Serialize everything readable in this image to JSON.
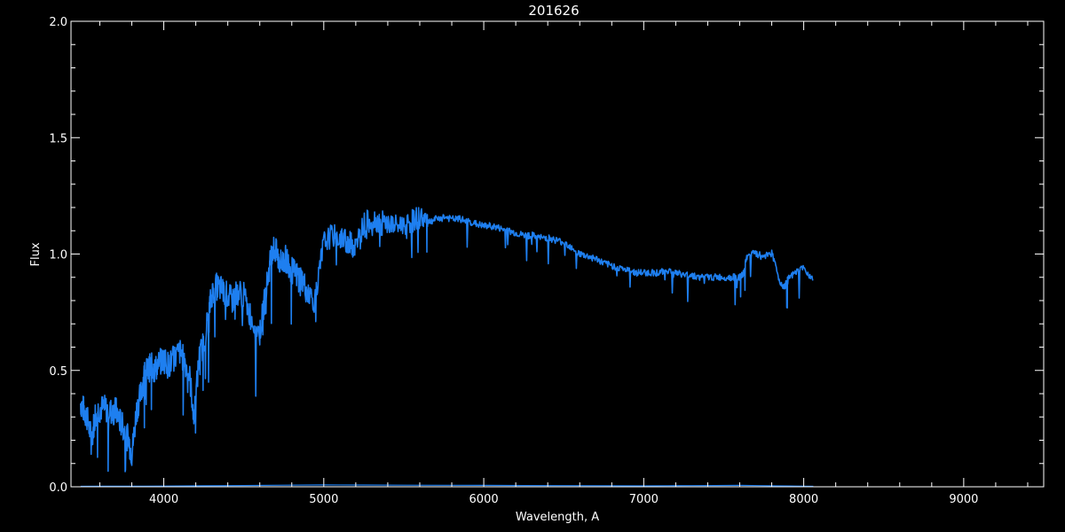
{
  "chart_data": {
    "type": "line",
    "title": "201626",
    "xlabel": "Wavelength, A",
    "ylabel": "Flux",
    "xlim": [
      3420,
      9500
    ],
    "ylim": [
      0,
      2.0
    ],
    "x_ticks": [
      4000,
      5000,
      6000,
      7000,
      8000,
      9000
    ],
    "x_tick_labels": [
      "4000",
      "5000",
      "6000",
      "7000",
      "8000",
      "9000"
    ],
    "y_ticks": [
      0.0,
      0.5,
      1.0,
      1.5,
      2.0
    ],
    "y_tick_labels": [
      "0.0",
      "0.5",
      "1.0",
      "1.5",
      "2.0"
    ],
    "background_color": "#000000",
    "axis_color": "#ffffff",
    "grid": false,
    "series": [
      {
        "color": "#1e7ff0",
        "x": [
          3480,
          3500,
          3520,
          3550,
          3570,
          3590,
          3620,
          3650,
          3680,
          3700,
          3720,
          3750,
          3780,
          3800,
          3830,
          3860,
          3880,
          3900,
          3920,
          3940,
          3970,
          4000,
          4030,
          4060,
          4100,
          4130,
          4160,
          4190,
          4220,
          4250,
          4280,
          4300,
          4330,
          4360,
          4400,
          4430,
          4460,
          4500,
          4550,
          4600,
          4630,
          4660,
          4680,
          4700,
          4720,
          4740,
          4760,
          4780,
          4800,
          4830,
          4860,
          4900,
          4950,
          5000,
          5050,
          5100,
          5130,
          5160,
          5180,
          5200,
          5250,
          5300,
          5350,
          5400,
          5450,
          5500,
          5550,
          5600,
          5640,
          5660,
          5700,
          5750,
          5800,
          5850,
          5900,
          5950,
          6000,
          6050,
          6100,
          6150,
          6200,
          6250,
          6300,
          6350,
          6400,
          6450,
          6500,
          6550,
          6600,
          6650,
          6700,
          6750,
          6800,
          6850,
          6900,
          6950,
          7000,
          7050,
          7100,
          7150,
          7200,
          7250,
          7300,
          7350,
          7400,
          7450,
          7500,
          7550,
          7600,
          7620,
          7650,
          7700,
          7750,
          7800,
          7850,
          7880,
          7900,
          7950,
          8000,
          8060
        ],
        "y": [
          0.36,
          0.33,
          0.3,
          0.2,
          0.31,
          0.33,
          0.34,
          0.33,
          0.32,
          0.33,
          0.29,
          0.25,
          0.2,
          0.14,
          0.33,
          0.41,
          0.49,
          0.5,
          0.52,
          0.5,
          0.53,
          0.55,
          0.52,
          0.55,
          0.58,
          0.54,
          0.48,
          0.3,
          0.55,
          0.62,
          0.74,
          0.83,
          0.86,
          0.85,
          0.82,
          0.8,
          0.84,
          0.82,
          0.72,
          0.66,
          0.8,
          0.94,
          1.03,
          1.01,
          0.97,
          0.96,
          0.98,
          0.96,
          0.93,
          0.91,
          0.9,
          0.83,
          0.8,
          1.05,
          1.08,
          1.07,
          1.06,
          1.05,
          1.04,
          1.03,
          1.13,
          1.15,
          1.14,
          1.13,
          1.12,
          1.13,
          1.14,
          1.16,
          1.15,
          1.14,
          1.15,
          1.16,
          1.15,
          1.15,
          1.14,
          1.13,
          1.12,
          1.12,
          1.11,
          1.1,
          1.09,
          1.08,
          1.08,
          1.07,
          1.07,
          1.06,
          1.05,
          1.03,
          1.0,
          0.99,
          0.98,
          0.96,
          0.95,
          0.94,
          0.93,
          0.92,
          0.92,
          0.92,
          0.92,
          0.93,
          0.92,
          0.91,
          0.91,
          0.9,
          0.9,
          0.9,
          0.9,
          0.9,
          0.9,
          0.91,
          1.0,
          1.0,
          0.99,
          1.01,
          0.88,
          0.86,
          0.89,
          0.92,
          0.94,
          0.89
        ]
      },
      {
        "color": "#1e7ff0",
        "x": [
          3480,
          4000,
          5000,
          6000,
          7000,
          7600,
          8060
        ],
        "y": [
          0.002,
          0.003,
          0.008,
          0.006,
          0.004,
          0.006,
          0.002
        ]
      }
    ]
  }
}
